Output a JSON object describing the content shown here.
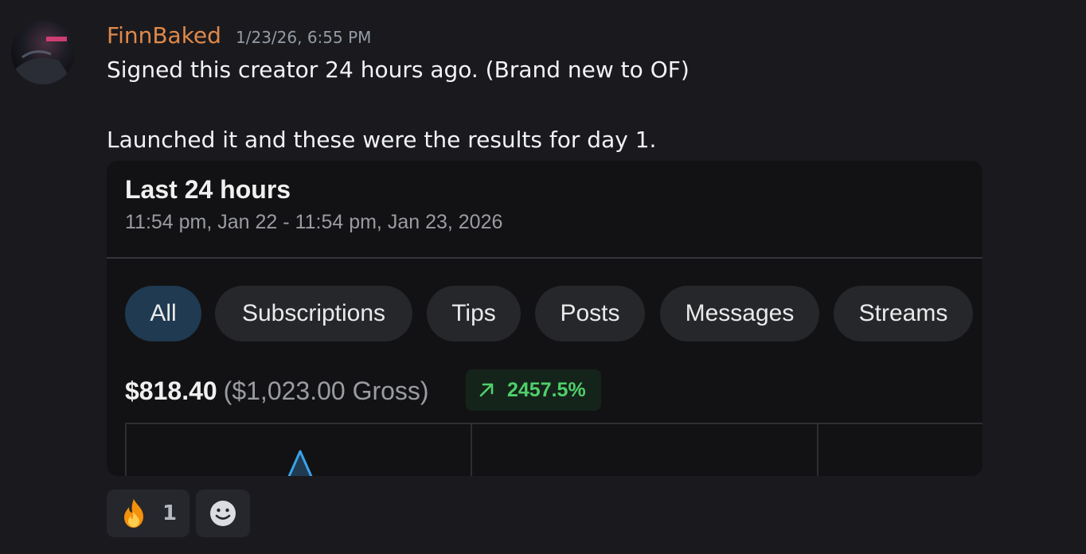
{
  "message": {
    "author": "FinnBaked",
    "timestamp": "1/23/26, 6:55 PM",
    "lines": [
      "Signed this creator 24 hours ago. (Brand new to OF)",
      "Launched it and these were the results for day 1."
    ],
    "colors": {
      "author": "#e0894a",
      "text": "#f2f3f5",
      "background": "#1a1a1e"
    }
  },
  "attachment": {
    "title": "Last 24 hours",
    "range": "11:54 pm, Jan 22 - 11:54 pm, Jan 23, 2026",
    "filters": [
      {
        "label": "All",
        "active": true
      },
      {
        "label": "Subscriptions",
        "active": false
      },
      {
        "label": "Tips",
        "active": false
      },
      {
        "label": "Posts",
        "active": false
      },
      {
        "label": "Messages",
        "active": false
      },
      {
        "label": "Streams",
        "active": false
      }
    ],
    "net": "$818.40",
    "gross": "($1,023.00 Gross)",
    "growth": {
      "icon": "trend-up-arrow-icon",
      "value": "2457.5%",
      "color": "#4fcf6b"
    },
    "colors": {
      "active_chip": "#1f3a51",
      "chip": "#26272b",
      "chart_peak": "#3aa3e8"
    }
  },
  "reactions": [
    {
      "emoji": "fire-emoji-icon",
      "count": "1"
    },
    {
      "emoji": "add-reaction-icon",
      "count": ""
    }
  ]
}
